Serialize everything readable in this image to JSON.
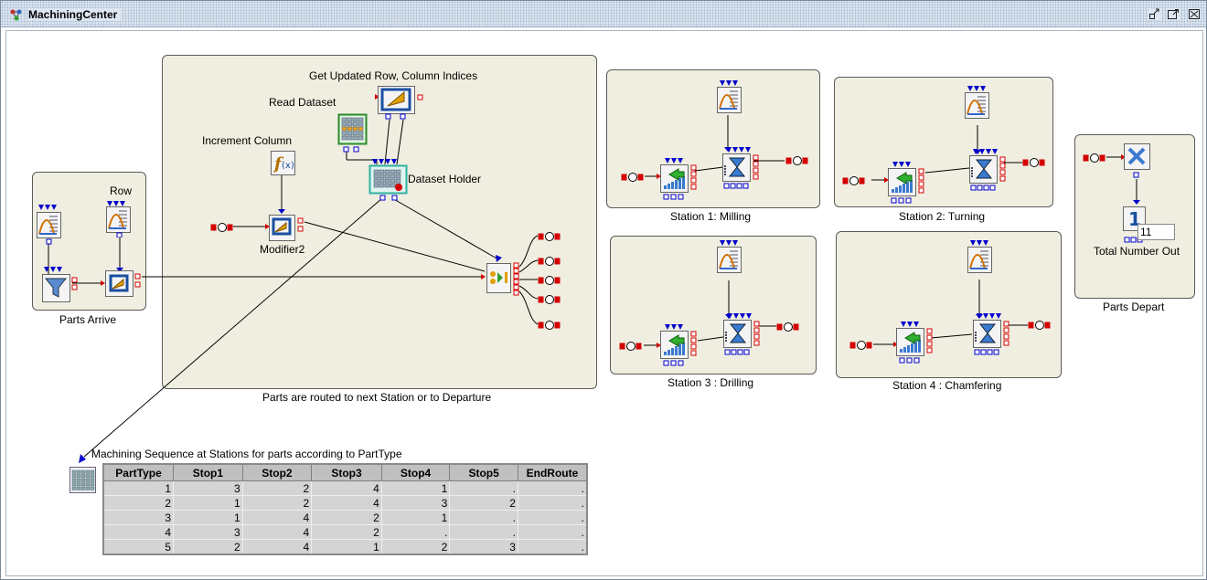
{
  "window": {
    "title": "MachiningCenter",
    "icons": [
      "app-icon",
      "restore-icon",
      "maximize-icon",
      "close-icon"
    ]
  },
  "groups": {
    "parts_arrive": "Parts Arrive",
    "routing": "Parts are routed to next Station or to Departure",
    "station1": "Station 1: Milling",
    "station2": "Station 2: Turning",
    "station3": "Station 3 : Drilling",
    "station4": "Station 4 : Chamfering",
    "parts_depart": "Parts Depart"
  },
  "labels": {
    "row": "Row",
    "get_updated": "Get Updated Row, Column Indices",
    "read_dataset": "Read Dataset",
    "increment_column": "Increment Column",
    "dataset_holder": "Dataset Holder",
    "modifier2": "Modifier2",
    "total_number_out": "Total Number Out",
    "total_value": "11",
    "table_caption": "Machining Sequence at Stations for parts according to PartType"
  },
  "table": {
    "headers": [
      "PartType",
      "Stop1",
      "Stop2",
      "Stop3",
      "Stop4",
      "Stop5",
      "EndRoute"
    ],
    "rows": [
      [
        "1",
        "3",
        "2",
        "4",
        "1",
        ".",
        "."
      ],
      [
        "2",
        "1",
        "2",
        "4",
        "3",
        "2",
        "."
      ],
      [
        "3",
        "1",
        "4",
        "2",
        "1",
        ".",
        "."
      ],
      [
        "4",
        "3",
        "4",
        "2",
        ".",
        ".",
        "."
      ],
      [
        "5",
        "2",
        "4",
        "1",
        "2",
        "3",
        "."
      ]
    ]
  },
  "colors": {
    "canvas": "#ffffff",
    "group_fill": "#efeee0",
    "port_red": "#d40000",
    "port_blue": "#0000cc",
    "wire": "#000000"
  }
}
